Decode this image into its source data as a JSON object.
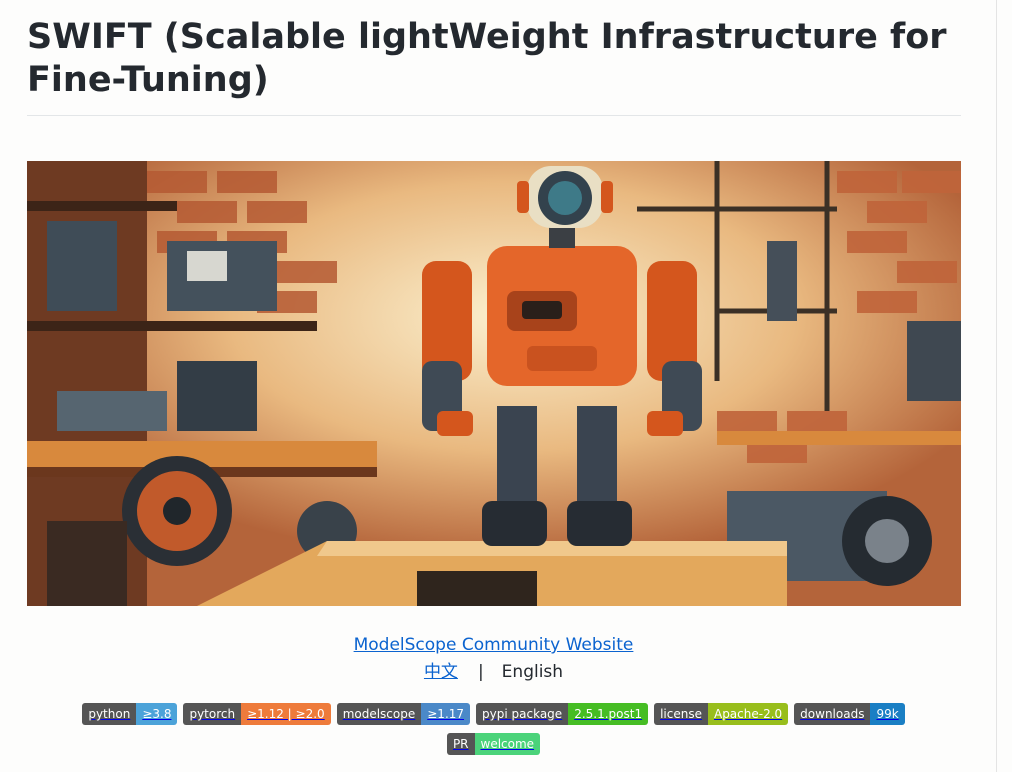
{
  "page": {
    "title": "SWIFT (Scalable lightWeight Infrastructure for Fine-Tuning)"
  },
  "hero": {
    "description": "Illustration of an orange robot standing in a cluttered brick workshop"
  },
  "links": {
    "community": "ModelScope Community Website",
    "lang_zh": "中文",
    "separator": "|",
    "lang_en": "English"
  },
  "badges": [
    {
      "name": "badge-python",
      "label": "python",
      "value": "≥3.8",
      "color": "#4ca3d9"
    },
    {
      "name": "badge-pytorch",
      "label": "pytorch",
      "value": "≥1.12 | ≥2.0",
      "color": "#ee7b3b"
    },
    {
      "name": "badge-modelscope",
      "label": "modelscope",
      "value": "≥1.17",
      "color": "#4b89c8"
    },
    {
      "name": "badge-pypi-package",
      "label": "pypi package",
      "value": "2.5.1.post1",
      "color": "#46bd24"
    },
    {
      "name": "badge-license",
      "label": "license",
      "value": "Apache-2.0",
      "color": "#98be1c"
    },
    {
      "name": "badge-downloads",
      "label": "downloads",
      "value": "99k",
      "color": "#1a7fc4"
    },
    {
      "name": "badge-pr",
      "label": "PR",
      "value": "welcome",
      "color": "#4bd37a"
    }
  ]
}
